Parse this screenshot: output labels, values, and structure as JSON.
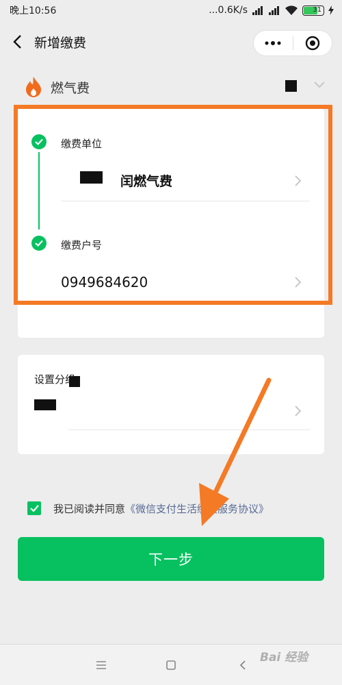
{
  "status_bar": {
    "time": "晚上10:56",
    "network_speed": "...0.6K/s",
    "battery_level": "31"
  },
  "nav": {
    "title": "新增缴费"
  },
  "bill_type": {
    "icon": "flame-icon",
    "label": "燃气费"
  },
  "steps": [
    {
      "label": "缴费单位",
      "value": "闰燃气费"
    },
    {
      "label": "缴费户号",
      "value": "0949684620"
    }
  ],
  "group": {
    "label": "设置分组"
  },
  "agreement": {
    "checked": true,
    "text": "我已阅读并同意",
    "link": "《微信支付生活缴费服务协议》"
  },
  "next_button": {
    "label": "下一步"
  },
  "watermark": {
    "text": "Bai 经验"
  },
  "colors": {
    "accent_green": "#07c160",
    "highlight_orange": "#f47a26",
    "link_blue": "#576b95",
    "flame_orange": "#f26b1d"
  }
}
